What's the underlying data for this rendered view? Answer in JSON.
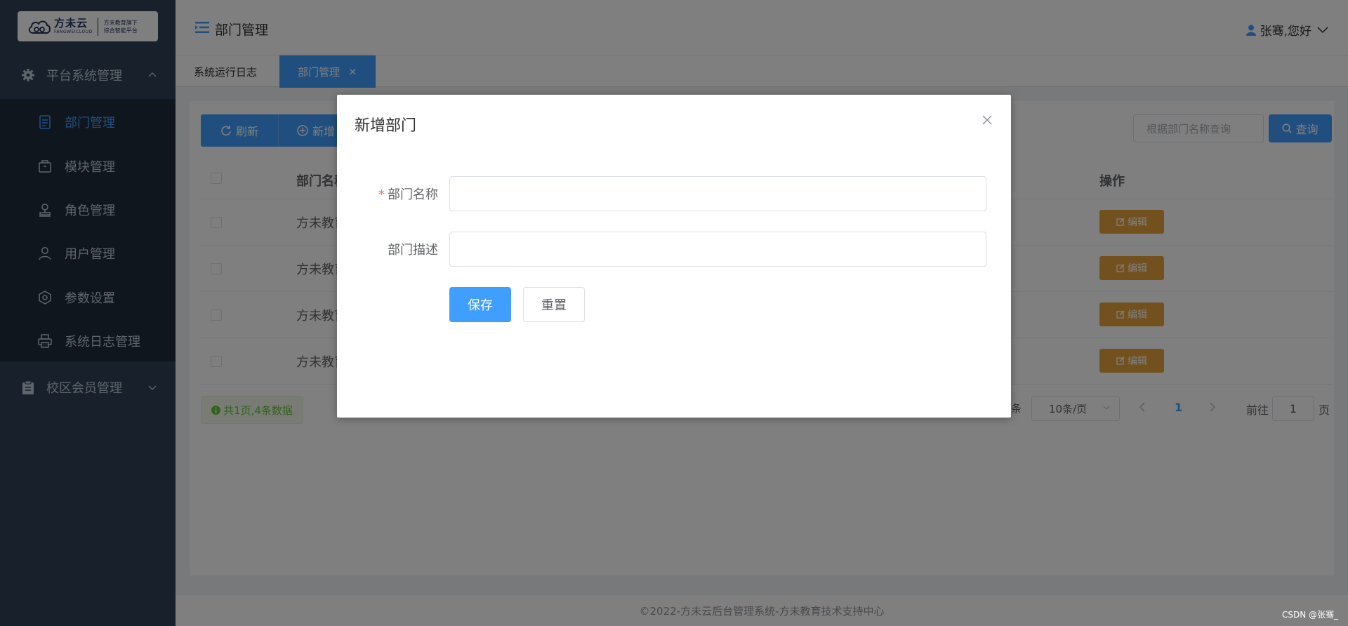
{
  "logo": {
    "brand_cn": "方未云",
    "brand_en": "FANGWEICLOUD",
    "slogan_line1": "方未教育旗下",
    "slogan_line2": "综合智能平台"
  },
  "sidebar": {
    "group1": {
      "label": "平台系统管理",
      "icon": "gear-icon",
      "expanded": true
    },
    "items": [
      {
        "label": "部门管理",
        "icon": "document-icon",
        "active": true
      },
      {
        "label": "模块管理",
        "icon": "box-icon",
        "active": false
      },
      {
        "label": "角色管理",
        "icon": "stamp-icon",
        "active": false
      },
      {
        "label": "用户管理",
        "icon": "user-icon",
        "active": false
      },
      {
        "label": "参数设置",
        "icon": "settings-icon",
        "active": false
      },
      {
        "label": "系统日志管理",
        "icon": "printer-icon",
        "active": false
      }
    ],
    "group2": {
      "label": "校区会员管理",
      "icon": "clipboard-icon",
      "expanded": false
    }
  },
  "header": {
    "title": "部门管理",
    "user_greeting": "张骞,您好"
  },
  "tabs": [
    {
      "label": "系统运行日志",
      "active": false
    },
    {
      "label": "部门管理",
      "active": true,
      "close": "×"
    }
  ],
  "toolbar": {
    "refresh_label": "刷新",
    "add_label": "新增",
    "search_placeholder": "根据部门名称查询",
    "query_label": "查询"
  },
  "table": {
    "col_name": "部门名称",
    "col_action": "操作",
    "rows": [
      {
        "name": "方未教育",
        "edit": "编辑"
      },
      {
        "name": "方未教育",
        "edit": "编辑"
      },
      {
        "name": "方未教育",
        "edit": "编辑"
      },
      {
        "name": "方未教育",
        "edit": "编辑"
      }
    ]
  },
  "summary": {
    "count_text": "共1页,4条数据"
  },
  "pagination": {
    "total_suffix": "条",
    "page_size": "10条/页",
    "current_page": "1",
    "goto_label": "前往",
    "goto_value": "1",
    "page_label": "页"
  },
  "footer": {
    "text": "©2022-方未云后台管理系统-方未教育技术支持中心"
  },
  "dialog": {
    "title": "新增部门",
    "field1_label": "部门名称",
    "field1_required": "*",
    "field1_value": "",
    "field2_label": "部门描述",
    "field2_value": "",
    "save_label": "保存",
    "reset_label": "重置"
  },
  "watermark": "CSDN @张骞_",
  "colors": {
    "primary": "#409eff",
    "sidebar": "#304156",
    "warning": "#e6a23c",
    "success": "#67c23a"
  }
}
